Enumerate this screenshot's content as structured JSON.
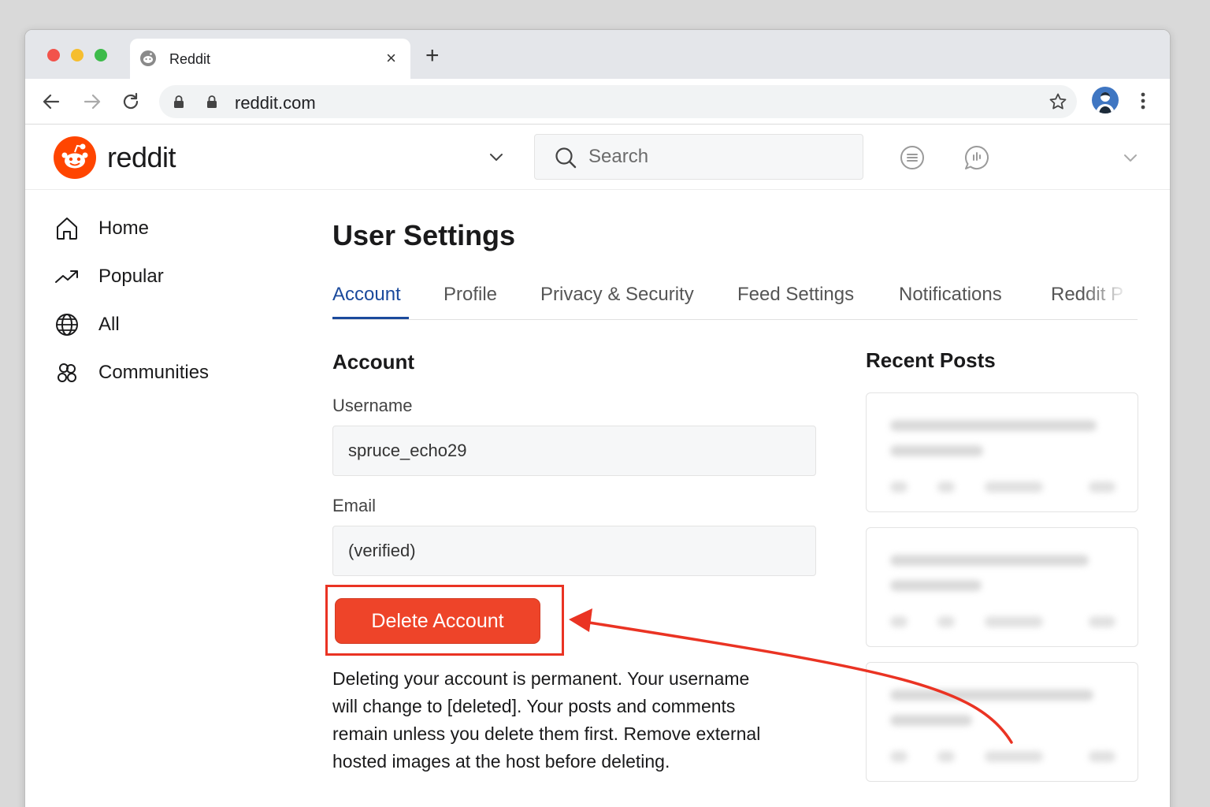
{
  "browser": {
    "tab_title": "Reddit",
    "tab_close": "×",
    "new_tab": "+",
    "url": "reddit.com"
  },
  "header": {
    "wordmark": "reddit",
    "search_placeholder": "Search"
  },
  "sidebar": {
    "items": [
      {
        "label": "Home",
        "icon": "home-icon"
      },
      {
        "label": "Popular",
        "icon": "trending-icon"
      },
      {
        "label": "All",
        "icon": "globe-icon"
      },
      {
        "label": "Communities",
        "icon": "communities-icon"
      }
    ]
  },
  "settings": {
    "title": "User Settings",
    "tabs": [
      "Account",
      "Profile",
      "Privacy & Security",
      "Feed Settings",
      "Notifications",
      "Reddit P"
    ],
    "active_tab": "Account"
  },
  "account": {
    "section_title": "Account",
    "username_label": "Username",
    "username_value": "spruce_echo29",
    "email_label": "Email",
    "email_value": "(verified)",
    "delete_button": "Delete Account",
    "warning_lines": [
      "Deleting your account is permanent. Your username",
      "will change to [deleted]. Your posts and comments",
      "remain unless you delete them first. Remove external",
      "hosted images at the host before deleting."
    ]
  },
  "recent_posts": {
    "title": "Recent Posts"
  },
  "colors": {
    "reddit_orange": "#ff4500",
    "delete_red": "#ee4429",
    "annotation_red": "#ea3323",
    "active_tab_blue": "#1b4a9c"
  }
}
